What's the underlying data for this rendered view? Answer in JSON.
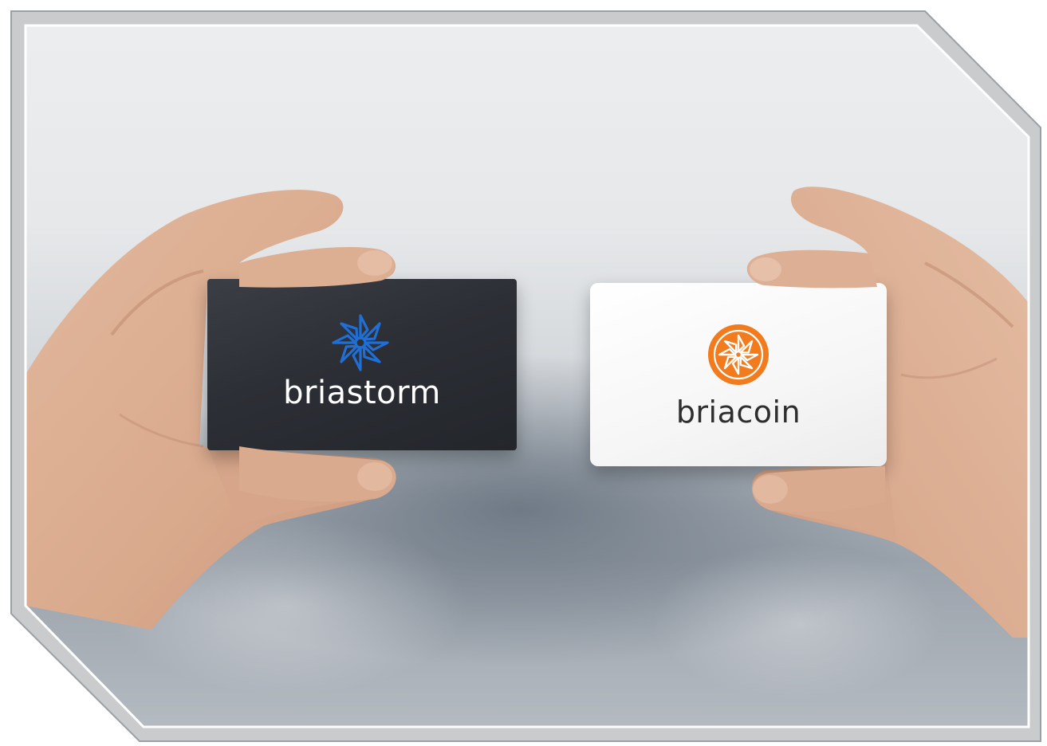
{
  "scene": {
    "background_color": "#d8dbde",
    "frame_color": "#ffffff"
  },
  "cards": [
    {
      "wordmark": "briastorm",
      "card_color": "#2c2f35",
      "logo_color": "#1f6fd6",
      "logo_icon": "flower-star-icon",
      "text_color": "#ffffff"
    },
    {
      "wordmark": "briacoin",
      "card_color": "#f7f7f7",
      "logo_color": "#f27b1e",
      "logo_icon": "coin-flower-icon",
      "text_color": "#2e2e2e"
    }
  ]
}
